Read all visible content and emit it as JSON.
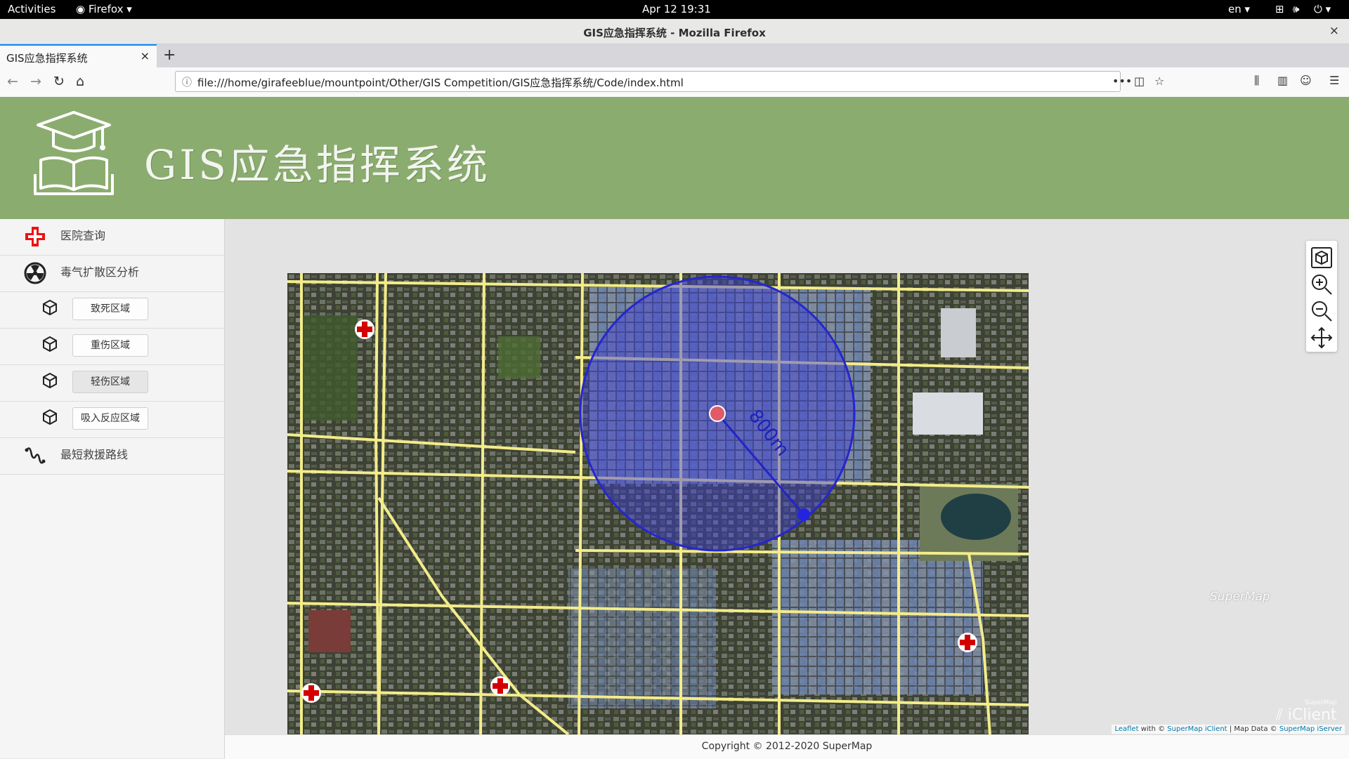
{
  "system": {
    "activities": "Activities",
    "app_menu": "Firefox",
    "clock": "Apr 12  19:31",
    "language": "en"
  },
  "window": {
    "title": "GIS应急指挥系统 - Mozilla Firefox",
    "close": "×"
  },
  "tab": {
    "label": "GIS应急指挥系统",
    "close": "×",
    "new_tab": "+"
  },
  "address_bar": {
    "url": "file:///home/girafeeblue/mountpoint/Other/GIS Competition/GIS应急指挥系统/Code/index.html"
  },
  "header": {
    "title": "GIS应急指挥系统"
  },
  "sidebar": {
    "items": [
      {
        "label": "医院查询",
        "icon": "hospital-cross-icon"
      },
      {
        "label": "毒气扩散区分析",
        "icon": "radiation-icon"
      }
    ],
    "zones": [
      {
        "label": "致死区域",
        "icon": "cube-icon"
      },
      {
        "label": "重伤区域",
        "icon": "cube-icon"
      },
      {
        "label": "轻伤区域",
        "icon": "cube-icon",
        "active": true
      },
      {
        "label": "吸入反应区域",
        "icon": "cube-icon"
      }
    ],
    "route": {
      "label": "最短救援路线",
      "icon": "route-icon"
    }
  },
  "map": {
    "measure_label": "800m",
    "buffer_color": "#3b3bd9",
    "road_color": "#f3ec8a",
    "hospital_marker_color": "#d40000",
    "watermark": "SuperMap",
    "iclient_mark": {
      "top": "SuperMap",
      "bottom": "iClient"
    }
  },
  "map_controls": [
    "3d-cube-icon",
    "zoom-in-icon",
    "zoom-out-icon",
    "pan-icon"
  ],
  "attribution": {
    "leaflet": "Leaflet",
    "with": " with © ",
    "iclient": "SuperMap iClient",
    "data": " | Map Data © ",
    "iserver": "SuperMap iServer"
  },
  "footer": {
    "copyright": "Copyright © 2012-2020 SuperMap"
  }
}
